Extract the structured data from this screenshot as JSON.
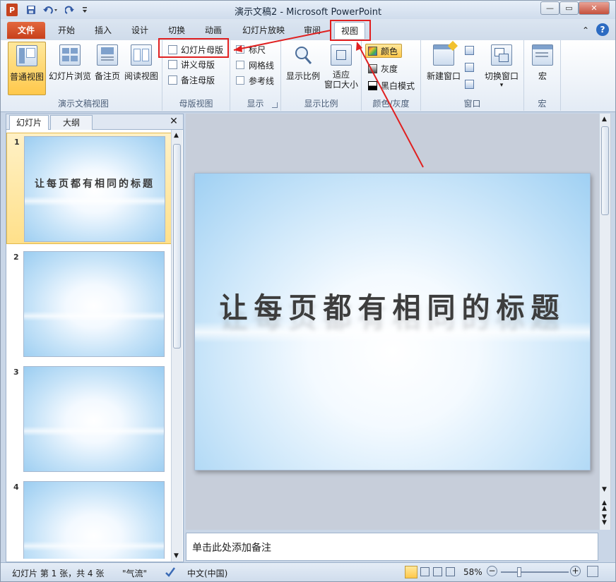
{
  "window": {
    "title": "演示文稿2 - Microsoft PowerPoint",
    "minimize": "—",
    "maximize": "▭",
    "close": "✕"
  },
  "quick_access": {
    "app_icon": "P",
    "save_icon": "save-icon",
    "undo_icon": "undo-icon",
    "redo_icon": "redo-icon",
    "customize_icon": "dropdown-icon"
  },
  "tabs": {
    "file": "文件",
    "items": [
      "开始",
      "插入",
      "设计",
      "切换",
      "动画",
      "幻灯片放映",
      "审阅"
    ],
    "view": "视图",
    "help": "?",
    "collapse": "⌃"
  },
  "ribbon": {
    "views_group": {
      "label": "演示文稿视图",
      "normal": "普通视图",
      "sorter": "幻灯片浏览",
      "notes_page": "备注页",
      "reading": "阅读视图"
    },
    "master_group": {
      "label": "母版视图",
      "slide_master": "幻灯片母版",
      "handout_master": "讲义母版",
      "notes_master": "备注母版"
    },
    "show_group": {
      "label": "显示",
      "ruler": "标尺",
      "gridlines": "网格线",
      "guides": "参考线"
    },
    "zoom_group": {
      "label": "显示比例",
      "zoom": "显示比例",
      "fit_line1": "适应",
      "fit_line2": "窗口大小"
    },
    "color_group": {
      "label": "颜色/灰度",
      "color": "颜色",
      "grayscale": "灰度",
      "black_white": "黑白模式"
    },
    "window_group": {
      "label": "窗口",
      "new_window": "新建窗口",
      "switch_window": "切换窗口"
    },
    "macro_group": {
      "label": "宏",
      "macros": "宏"
    }
  },
  "left_pane": {
    "tab_slides": "幻灯片",
    "tab_outline": "大纲",
    "close": "✕",
    "thumbnails": [
      {
        "num": "1",
        "title": "让每页都有相同的标题"
      },
      {
        "num": "2",
        "title": ""
      },
      {
        "num": "3",
        "title": ""
      },
      {
        "num": "4",
        "title": ""
      }
    ]
  },
  "slide": {
    "title": "让每页都有相同的标题"
  },
  "notes": {
    "placeholder": "单击此处添加备注"
  },
  "status": {
    "slide_info": "幻灯片 第 1 张，共 4 张",
    "theme": "\"气流\"",
    "language": "中文(中国)",
    "zoom": "58%",
    "zoom_level": 0.58
  },
  "colors": {
    "file_tab": "#d0532b",
    "annotation": "#e02020",
    "selection": "#ffd35e"
  }
}
